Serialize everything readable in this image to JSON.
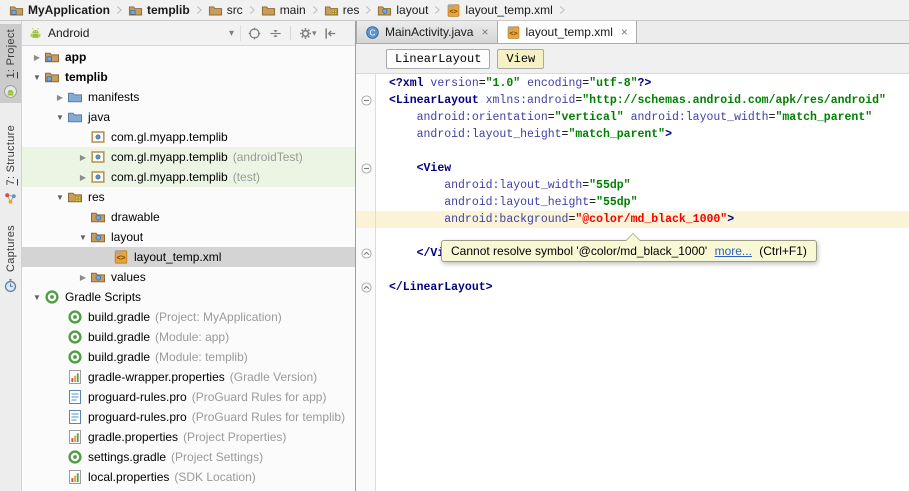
{
  "colors": {
    "selection_bg": "#d4d4d4",
    "test_source_bg": "#ecf4e3",
    "current_line_bg": "#fbf3d8",
    "xml_tag": "#000080",
    "xml_attribute": "#3f3fa6",
    "xml_value": "#008000",
    "error_text": "#f40000",
    "tooltip_bg": "#f9f8d4",
    "link": "#2e5fc0",
    "android_green": "#9cbf3b"
  },
  "breadcrumb": {
    "items": [
      {
        "label": "MyApplication",
        "icon": "folder-module",
        "bold": true
      },
      {
        "label": "templib",
        "icon": "folder-module",
        "bold": true
      },
      {
        "label": "src",
        "icon": "folder-plain",
        "bold": false
      },
      {
        "label": "main",
        "icon": "folder-plain",
        "bold": false
      },
      {
        "label": "res",
        "icon": "folder-res",
        "bold": false
      },
      {
        "label": "layout",
        "icon": "folder-resdir",
        "bold": false
      },
      {
        "label": "layout_temp.xml",
        "icon": "xml-file",
        "bold": false
      }
    ]
  },
  "stripe": {
    "tabs": [
      {
        "mnemonic": "1",
        "label": ": Project",
        "icon": "project-view",
        "active": true
      },
      {
        "mnemonic": "7",
        "label": ": Structure",
        "icon": "structure-view",
        "active": false
      },
      {
        "mnemonic": "",
        "label": "Captures",
        "icon": "captures-view",
        "active": false
      }
    ]
  },
  "project_panel": {
    "view_selector": {
      "label": "Android",
      "icon": "android-logo",
      "caret": "▾"
    },
    "toolbar": [
      {
        "name": "locate",
        "icon": "target"
      },
      {
        "name": "collapse-all",
        "icon": "collapse-all"
      },
      {
        "name": "settings",
        "icon": "gear",
        "caret": "▾"
      },
      {
        "name": "hide",
        "icon": "hide-left"
      }
    ],
    "tree": [
      {
        "label": "app",
        "suffix": "",
        "level": 0,
        "icon": "folder-module",
        "arrow": "collapsed",
        "bold": true,
        "bg": "none"
      },
      {
        "label": "templib",
        "suffix": "",
        "level": 0,
        "icon": "folder-module",
        "arrow": "expanded",
        "bold": true,
        "bg": "none"
      },
      {
        "label": "manifests",
        "suffix": "",
        "level": 1,
        "icon": "folder-blue",
        "arrow": "collapsed",
        "bold": false,
        "bg": "none"
      },
      {
        "label": "java",
        "suffix": "",
        "level": 1,
        "icon": "folder-blue",
        "arrow": "expanded",
        "bold": false,
        "bg": "none"
      },
      {
        "label": "com.gl.myapp.templib",
        "suffix": "",
        "level": 2,
        "icon": "package",
        "arrow": "none",
        "bold": false,
        "bg": "none"
      },
      {
        "label": "com.gl.myapp.templib",
        "suffix": "(androidTest)",
        "level": 2,
        "icon": "package",
        "arrow": "collapsed",
        "bold": false,
        "bg": "green"
      },
      {
        "label": "com.gl.myapp.templib",
        "suffix": "(test)",
        "level": 2,
        "icon": "package",
        "arrow": "collapsed",
        "bold": false,
        "bg": "green"
      },
      {
        "label": "res",
        "suffix": "",
        "level": 1,
        "icon": "folder-res",
        "arrow": "expanded",
        "bold": false,
        "bg": "none"
      },
      {
        "label": "drawable",
        "suffix": "",
        "level": 2,
        "icon": "folder-resdir",
        "arrow": "none",
        "bold": false,
        "bg": "none"
      },
      {
        "label": "layout",
        "suffix": "",
        "level": 2,
        "icon": "folder-resdir",
        "arrow": "expanded",
        "bold": false,
        "bg": "none"
      },
      {
        "label": "layout_temp.xml",
        "suffix": "",
        "level": 3,
        "icon": "xml-file",
        "arrow": "none",
        "bold": false,
        "bg": "selected"
      },
      {
        "label": "values",
        "suffix": "",
        "level": 2,
        "icon": "folder-resdir",
        "arrow": "collapsed",
        "bold": false,
        "bg": "none"
      },
      {
        "label": "Gradle Scripts",
        "suffix": "",
        "level": 0,
        "icon": "gradle",
        "arrow": "expanded",
        "bold": false,
        "bg": "none"
      },
      {
        "label": "build.gradle",
        "suffix": "(Project: MyApplication)",
        "level": 1,
        "icon": "gradle",
        "arrow": "none",
        "bold": false,
        "bg": "none"
      },
      {
        "label": "build.gradle",
        "suffix": "(Module: app)",
        "level": 1,
        "icon": "gradle",
        "arrow": "none",
        "bold": false,
        "bg": "none"
      },
      {
        "label": "build.gradle",
        "suffix": "(Module: templib)",
        "level": 1,
        "icon": "gradle",
        "arrow": "none",
        "bold": false,
        "bg": "none"
      },
      {
        "label": "gradle-wrapper.properties",
        "suffix": "(Gradle Version)",
        "level": 1,
        "icon": "props",
        "arrow": "none",
        "bold": false,
        "bg": "none"
      },
      {
        "label": "proguard-rules.pro",
        "suffix": "(ProGuard Rules for app)",
        "level": 1,
        "icon": "textfile",
        "arrow": "none",
        "bold": false,
        "bg": "none"
      },
      {
        "label": "proguard-rules.pro",
        "suffix": "(ProGuard Rules for templib)",
        "level": 1,
        "icon": "textfile",
        "arrow": "none",
        "bold": false,
        "bg": "none"
      },
      {
        "label": "gradle.properties",
        "suffix": "(Project Properties)",
        "level": 1,
        "icon": "props",
        "arrow": "none",
        "bold": false,
        "bg": "none"
      },
      {
        "label": "settings.gradle",
        "suffix": "(Project Settings)",
        "level": 1,
        "icon": "gradle",
        "arrow": "none",
        "bold": false,
        "bg": "none"
      },
      {
        "label": "local.properties",
        "suffix": "(SDK Location)",
        "level": 1,
        "icon": "props",
        "arrow": "none",
        "bold": false,
        "bg": "none"
      }
    ]
  },
  "editor": {
    "tabs": [
      {
        "label": "MainActivity.java",
        "icon": "class-c",
        "selected": false,
        "close": "×"
      },
      {
        "label": "layout_temp.xml",
        "icon": "xml-file",
        "selected": true,
        "close": "×"
      }
    ],
    "breadcrumbs": [
      {
        "label": "LinearLayout",
        "active": false
      },
      {
        "label": "View",
        "active": true
      }
    ],
    "code": {
      "current_line": 9,
      "folds": {
        "2": "start",
        "6": "start",
        "11": "end",
        "13": "end"
      },
      "lines": [
        [
          [
            "t",
            "<?xml"
          ],
          [
            "p",
            " "
          ],
          [
            "a",
            "version"
          ],
          [
            "p",
            "="
          ],
          [
            "v",
            "\"1.0\""
          ],
          [
            "p",
            " "
          ],
          [
            "a",
            "encoding"
          ],
          [
            "p",
            "="
          ],
          [
            "v",
            "\"utf-8\""
          ],
          [
            "t",
            "?>"
          ]
        ],
        [
          [
            "t",
            "<LinearLayout"
          ],
          [
            "p",
            " "
          ],
          [
            "a",
            "xmlns:android"
          ],
          [
            "p",
            "="
          ],
          [
            "v",
            "\"http://schemas.android.com/apk/res/android\""
          ]
        ],
        [
          [
            "p",
            "    "
          ],
          [
            "a",
            "android:orientation"
          ],
          [
            "p",
            "="
          ],
          [
            "v",
            "\"vertical\""
          ],
          [
            "p",
            " "
          ],
          [
            "a",
            "android:layout_width"
          ],
          [
            "p",
            "="
          ],
          [
            "v",
            "\"match_parent\""
          ]
        ],
        [
          [
            "p",
            "    "
          ],
          [
            "a",
            "android:layout_height"
          ],
          [
            "p",
            "="
          ],
          [
            "v",
            "\"match_parent\""
          ],
          [
            "t",
            ">"
          ]
        ],
        [],
        [
          [
            "p",
            "    "
          ],
          [
            "t",
            "<View"
          ]
        ],
        [
          [
            "p",
            "        "
          ],
          [
            "a",
            "android:layout_width"
          ],
          [
            "p",
            "="
          ],
          [
            "v",
            "\"55dp\""
          ]
        ],
        [
          [
            "p",
            "        "
          ],
          [
            "a",
            "android:layout_height"
          ],
          [
            "p",
            "="
          ],
          [
            "v",
            "\"55dp\""
          ]
        ],
        [
          [
            "p",
            "        "
          ],
          [
            "a",
            "android:background"
          ],
          [
            "p",
            "="
          ],
          [
            "e",
            "\"@color/md_black_1000\""
          ],
          [
            "t",
            ">"
          ]
        ],
        [],
        [
          [
            "p",
            "    "
          ],
          [
            "t",
            "</View>"
          ]
        ],
        [],
        [
          [
            "t",
            "</LinearLayout>"
          ]
        ]
      ]
    },
    "tooltip": {
      "message": "Cannot resolve symbol '@color/md_black_1000'",
      "link": "more...",
      "shortcut": "(Ctrl+F1)"
    }
  }
}
